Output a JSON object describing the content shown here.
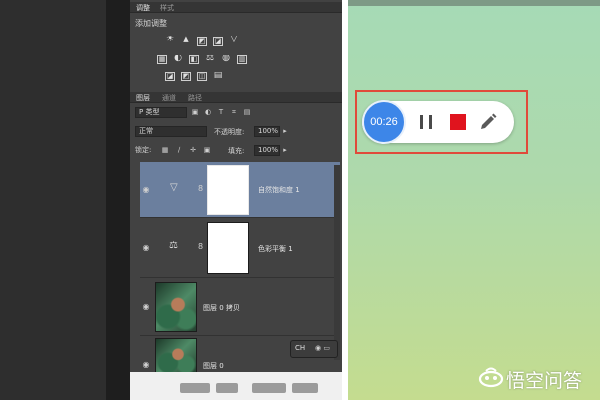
{
  "adjustments_panel": {
    "tabs": [
      "调整",
      "样式"
    ],
    "add_adjustment_label": "添加调整",
    "icon_rows": [
      [
        "☀",
        "▲",
        "◩",
        "◪",
        "▽"
      ],
      [
        "▦",
        "◐",
        "◧",
        "⚖",
        "◍",
        "▥"
      ],
      [
        "◪",
        "◩",
        "◫",
        "▤"
      ]
    ]
  },
  "layers_panel": {
    "tabs": [
      "图层",
      "通道",
      "路径"
    ],
    "filter_kind": "P 类型",
    "filter_icons": [
      "▣",
      "◐",
      "T",
      "⌗",
      "▤"
    ],
    "blend_mode": "正常",
    "opacity_label": "不透明度:",
    "opacity_value": "100%",
    "lock_label": "锁定:",
    "fill_label": "填充:",
    "fill_value": "100%",
    "layers": [
      {
        "name": "自然饱和度 1",
        "type": "adjustment",
        "glyph": "▽",
        "selected": true
      },
      {
        "name": "色彩平衡 1",
        "type": "adjustment",
        "glyph": "⚖",
        "selected": false
      },
      {
        "name": "图层 0 拷贝",
        "type": "photo",
        "selected": false
      },
      {
        "name": "图层 0",
        "type": "photo",
        "selected": false
      }
    ],
    "eye_glyph": "◉",
    "link_glyph": "8"
  },
  "channels_pill_label": "CH",
  "recorder": {
    "timer": "00:26",
    "colors": {
      "timer_bg": "#3d86e8",
      "stop": "#e0141e",
      "highlight": "#e04a3a"
    }
  },
  "watermark": {
    "text": "悟空问答"
  }
}
